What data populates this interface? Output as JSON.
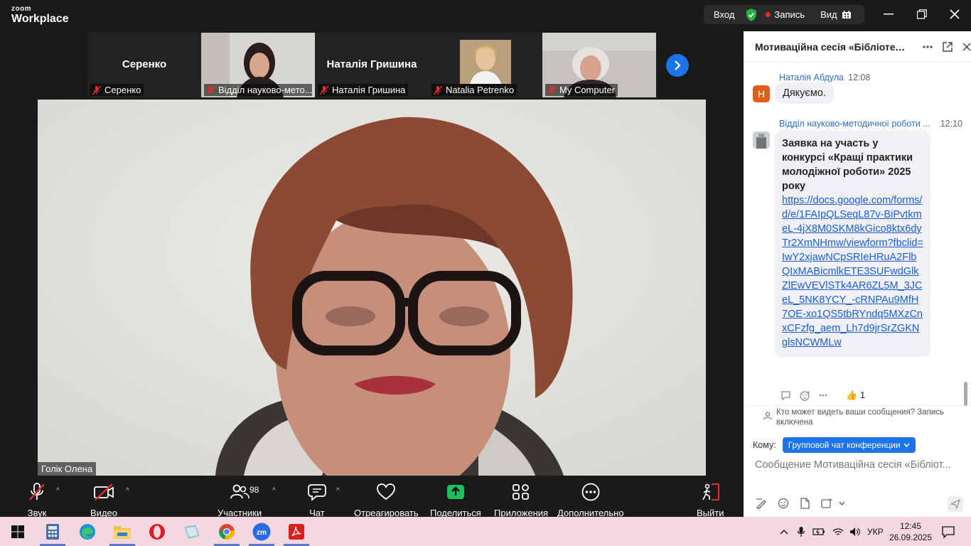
{
  "app": {
    "brand_small": "zoom",
    "brand_name": "Workplace"
  },
  "titlebar": {
    "enter_label": "Вход",
    "record_label": "Запись",
    "view_label": "Вид"
  },
  "thumbnails": [
    {
      "big_name": "Серенко",
      "label": "Серенко",
      "has_video": false
    },
    {
      "big_name": "",
      "label": "Відділ науково-мето...",
      "has_video": true
    },
    {
      "big_name": "Наталія Гришина",
      "label": "Наталія Гришина",
      "has_video": false
    },
    {
      "big_name": "",
      "label": "Natalia Petrenko",
      "has_video": true
    },
    {
      "big_name": "",
      "label": "My Computer",
      "has_video": true
    }
  ],
  "main_video": {
    "speaker_label": "Голік Олена"
  },
  "toolbar": {
    "audio_label": "Звук",
    "video_label": "Видео",
    "participants_label": "Участники",
    "participants_count": "98",
    "chat_label": "Чат",
    "react_label": "Отреагировать",
    "share_label": "Поделиться",
    "apps_label": "Приложения",
    "more_label": "Дополнительно",
    "leave_label": "Выйти"
  },
  "chat": {
    "title": "Мотиваційна сесія «Бібліотечн...",
    "messages": [
      {
        "sender": "Наталія Абдула",
        "time": "12:08",
        "avatar_letter": "Н",
        "text": "Дякуємо."
      },
      {
        "sender": "Відділ науково-методичної роботи ...",
        "time": "12:10",
        "bold_text": "Заявка на участь у конкурсі «Кращі практики молодіжної роботи» 2025 року",
        "link": "https://docs.google.com/forms/d/e/1FAIpQLSeqL87v-BiPvtkmeL-4jX8M0SKM8kGico8ktx6dyTr2XmNHmw/viewform?fbclid=IwY2xjawNCpSRIeHRuA2FlbQIxMABicmlkETE3SUFwdGlkZlEwVEVlSTk4AR6ZL5M_3JCeL_5NK8YCY_-cRNPAu9MfH7OE-xo1QS5tbRYndq5MXzCnxCFzfg_aem_Lh7d9jrSrZGKNglsNCWMLw",
        "reaction_emoji": "👍",
        "reaction_count": "1"
      }
    ],
    "visibility_notice": "Кто может видеть ваши сообщения? Запись включена",
    "to_label": "Кому:",
    "to_value": "Групповой чат конференции",
    "input_placeholder": "Сообщение Мотиваційна сесія «Бібліот..."
  },
  "taskbar": {
    "language": "УКР",
    "time": "12:45",
    "date": "26.09.2025"
  },
  "colors": {
    "accent": "#1d74e8",
    "danger": "#e02e2e",
    "link": "#1a5fd4",
    "taskbar": "#f3d9df"
  }
}
